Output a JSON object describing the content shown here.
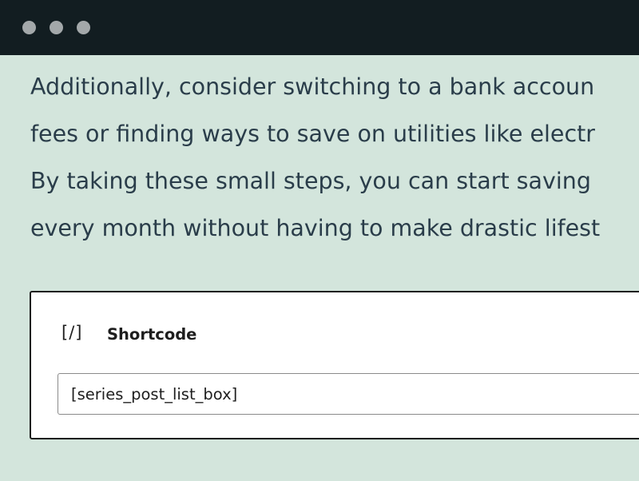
{
  "window": {
    "controls": [
      "close-dot",
      "minimize-dot",
      "maximize-dot"
    ]
  },
  "content": {
    "paragraph_lines": [
      "Additionally, consider switching to a bank accoun",
      "fees or finding ways to save on utilities like electr",
      "By taking these small steps, you can start saving",
      "every month without having to make drastic lifest"
    ]
  },
  "shortcode_block": {
    "icon": "[/]",
    "title": "Shortcode",
    "value": "[series_post_list_box]"
  },
  "colors": {
    "background": "#d3e5dc",
    "titlebar": "#121d21",
    "text": "#2a3d4a"
  }
}
